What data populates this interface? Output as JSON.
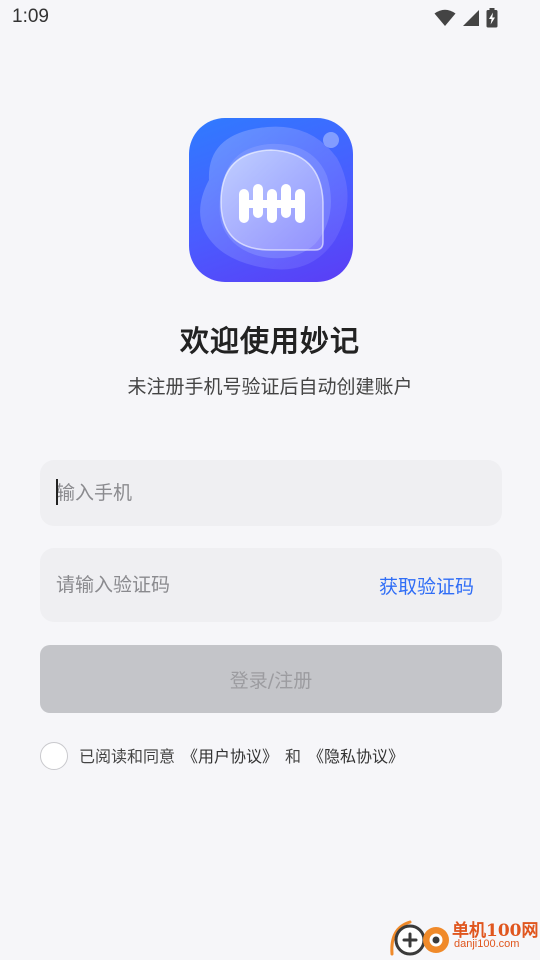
{
  "status_bar": {
    "time": "1:09",
    "icons": [
      "wifi-icon",
      "cell-signal-icon",
      "battery-charging-icon"
    ]
  },
  "app": {
    "logo_icon": "miaoji-logo-icon",
    "welcome_title": "欢迎使用妙记",
    "welcome_subtitle": "未注册手机号验证后自动创建账户"
  },
  "form": {
    "phone_placeholder": "输入手机",
    "phone_value": "",
    "code_placeholder": "请输入验证码",
    "code_value": "",
    "get_code_label": "获取验证码",
    "login_label": "登录/注册"
  },
  "agreement": {
    "checked": false,
    "text": "已阅读和同意",
    "user_agreement": "《用户协议》",
    "and_text": "和",
    "privacy_policy": "《隐私协议》"
  },
  "watermark": {
    "site_name": "单机100网",
    "site_url": "danji100.com"
  },
  "colors": {
    "background": "#f6f6f9",
    "field_background": "#efeff2",
    "accent_link": "#2f6df6",
    "button_disabled": "#c4c5c9",
    "logo_gradient_start": "#2f7bff",
    "logo_gradient_end": "#5b3df5",
    "watermark": "#e0561e"
  }
}
